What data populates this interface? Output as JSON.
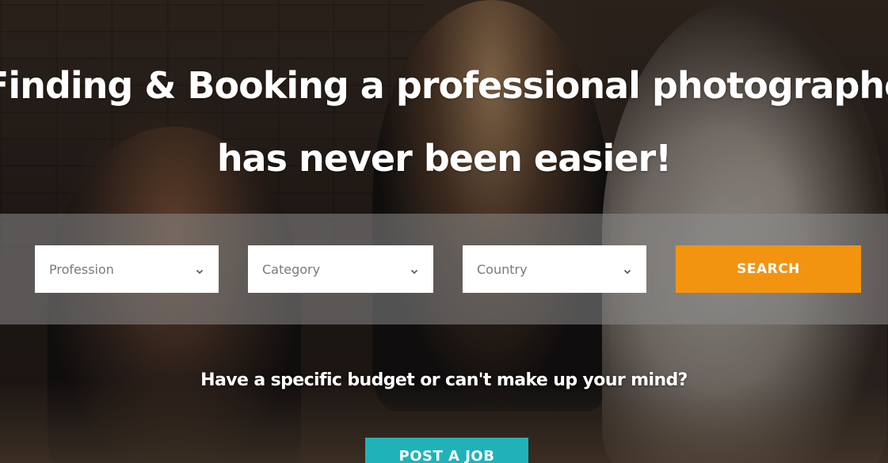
{
  "hero": {
    "headline_line1": "Finding & Booking a professional photographer",
    "headline_line2": "has never been easier!"
  },
  "search": {
    "profession": {
      "placeholder": "Profession",
      "icon": "chevron-down-icon"
    },
    "category": {
      "placeholder": "Category",
      "icon": "chevron-down-icon"
    },
    "country": {
      "placeholder": "Country",
      "icon": "chevron-down-icon"
    },
    "button_label": "SEARCH"
  },
  "cta": {
    "budget_text": "Have a specific budget or can't make up your mind?",
    "post_job_label": "POST A JOB"
  },
  "colors": {
    "search_button": "#f39410",
    "post_job_button": "#1fb3b8",
    "search_band": "#8c8c8c",
    "headline_text": "#ffffff"
  }
}
